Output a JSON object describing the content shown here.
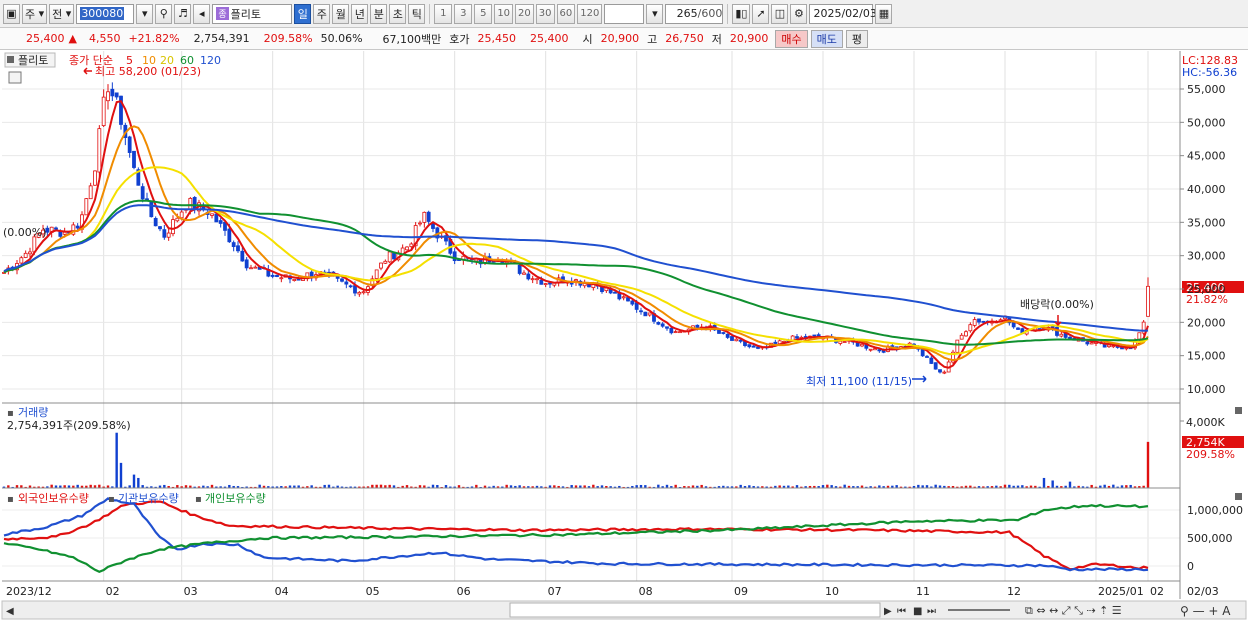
{
  "toolbar": {
    "period_main": "주",
    "compare": "전",
    "stock_code": "300080",
    "stock_name": "플리토",
    "stock_badge": "종",
    "period_tabs": [
      "일",
      "주",
      "월",
      "년",
      "분",
      "초",
      "틱"
    ],
    "active_period": "일",
    "intervals": [
      "1",
      "3",
      "5",
      "10",
      "20",
      "30",
      "60",
      "120"
    ],
    "count_value": "265",
    "count_max": "/600",
    "date": "2025/02/03"
  },
  "quote": {
    "price": "25,400",
    "change_arrow": "▲",
    "change": "4,550",
    "change_rate": "+21.82%",
    "volume": "2,754,391",
    "volume_ratio": "209.58%",
    "turnover_ratio": "50.06%",
    "amount": "67,100백만",
    "ask_label": "호가",
    "ask": "25,450",
    "bid": "25,400",
    "open_label": "시",
    "open": "20,900",
    "high_label": "고",
    "high": "26,750",
    "low_label": "저",
    "low": "20,900",
    "buy_label": "매수",
    "sell_label": "매도",
    "eval_label": "평"
  },
  "price_panel": {
    "stock_tab": "플리토",
    "ma_legend_prefix": "종가 단순",
    "ma_periods": [
      "5",
      "10",
      "20",
      "60",
      "120"
    ],
    "ma_colors": [
      "#e01010",
      "#f08c00",
      "#f5e000",
      "#109030",
      "#2050d0"
    ],
    "lc_label": "LC:128.83",
    "hc_label": "HC:-56.36",
    "high_marker": "최고 58,200 (01/23)",
    "low_marker": "최저 11,100 (11/15)",
    "dividend_marker": "배당락(0.00%)",
    "left_marker": "(0.00%)",
    "y_ticks": [
      "55,000",
      "50,000",
      "45,000",
      "40,000",
      "35,000",
      "30,000",
      "25,000",
      "20,000",
      "15,000",
      "10,000"
    ],
    "current_price": "25,400",
    "current_rate": "21.82%"
  },
  "volume_panel": {
    "title": "거래량",
    "summary": "2,754,391주(209.58%)",
    "y_tick": "4,000K",
    "current": "2,754K",
    "current_ratio": "209.58%"
  },
  "holding_panel": {
    "series_names": [
      "외국인보유수량",
      "기관보유수량",
      "개인보유수량"
    ],
    "colors": [
      "#e01010",
      "#2050d0",
      "#109030"
    ],
    "y_ticks": [
      "1,000,000",
      "500,000",
      "0"
    ]
  },
  "x_axis": {
    "labels": [
      "2023/12",
      "02",
      "03",
      "04",
      "05",
      "06",
      "07",
      "08",
      "09",
      "10",
      "11",
      "12",
      "2025/01",
      "02"
    ],
    "right_label": "02/03"
  },
  "colors": {
    "up": "#e01010",
    "down": "#1040d0",
    "grid": "#dcdcdc",
    "active_tab": "#2f6fd0"
  }
}
